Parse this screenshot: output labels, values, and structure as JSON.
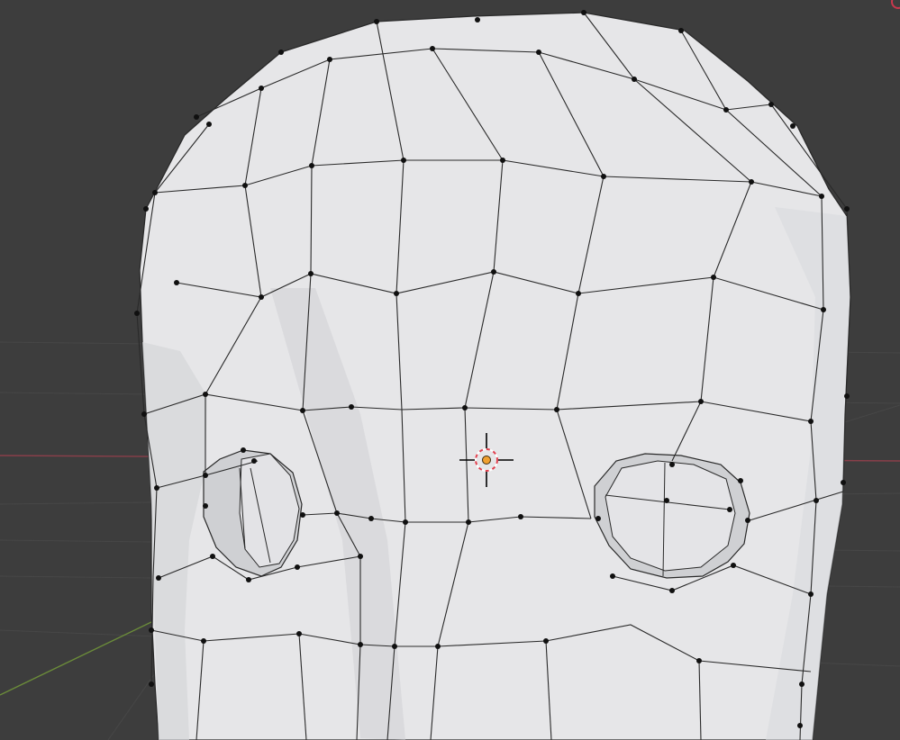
{
  "viewport": {
    "background_color": "#3d3d3d",
    "grid_line_color": "#474747",
    "x_axis_color": "#8a3f4a",
    "y_axis_color": "#6b8c3a",
    "mesh_face_color": "#e6e6e8",
    "mesh_shadow_color": "#c9cacd",
    "mesh_edge_color": "#2a2a2a",
    "vertex_color": "#101010",
    "cursor_ring_colors": [
      "#ffffff",
      "#e0404e"
    ],
    "origin_color": "#f0a030"
  },
  "objects": {
    "mesh": "head-mesh",
    "cursor": "3d-cursor-icon",
    "origin": "object-origin-icon",
    "corner_gizmo": "navigation-gizmo-icon"
  }
}
